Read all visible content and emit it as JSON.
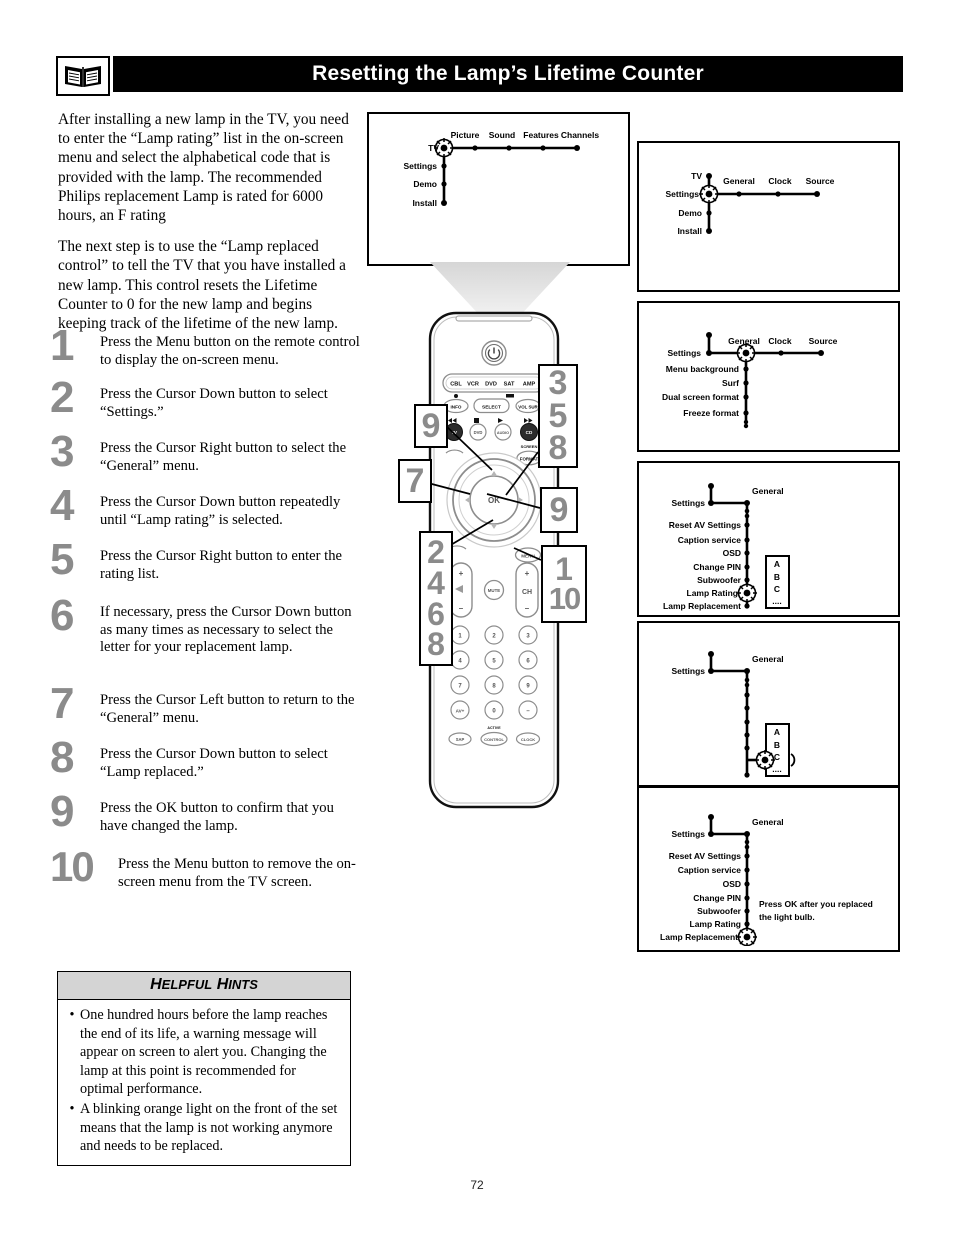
{
  "header": {
    "icon": "open-book-icon",
    "title": "Resetting the Lamp’s Lifetime Counter"
  },
  "intro": {
    "paragraph1": "After installing a new lamp in the TV, you need to enter the “Lamp rating” list in the on-screen menu and select the alphabetical code that is provided with the lamp. The recommended Philips replacement Lamp is rated for 6000 hours, an F rating",
    "paragraph2": "The next step is to use the “Lamp replaced control” to tell the TV that you have installed a new lamp. This control resets the Lifetime Counter to 0 for the new lamp and begins keeping track of the lifetime of the new lamp."
  },
  "steps": [
    {
      "num": "1",
      "text": "Press the Menu button on the remote control to display the on-screen menu."
    },
    {
      "num": "2",
      "text": "Press the Cursor Down button to select “Settings.”"
    },
    {
      "num": "3",
      "text": "Press the Cursor Right button to select the “General” menu."
    },
    {
      "num": "4",
      "text": "Press the Cursor Down button repeatedly until “Lamp rating” is selected."
    },
    {
      "num": "5",
      "text": "Press the Cursor Right button to enter the rating list."
    },
    {
      "num": "6",
      "text": "If necessary, press the Cursor Down button as many times as necessary to select the letter for your replacement lamp."
    },
    {
      "num": "7",
      "text": "Press the Cursor Left button to return to the “General” menu."
    },
    {
      "num": "8",
      "text": "Press the Cursor Down button to select “Lamp replaced.”"
    },
    {
      "num": "9",
      "text": "Press the OK button to confirm that you have changed the lamp."
    },
    {
      "num": "10",
      "text": "Press the Menu button to remove the on-screen menu from the TV screen."
    }
  ],
  "hints": {
    "title_first": "H",
    "title_rest1": "ELPFUL",
    "title_second": "H",
    "title_rest2": "INTS",
    "bullet": "•",
    "items": [
      "One hundred hours before the lamp reaches the end of its life, a warning message will appear on screen to alert you. Changing the lamp at this point is recommended for optimal performance.",
      "A blinking orange light on the front of the set means that the lamp is not working anymore and needs to be replaced."
    ]
  },
  "tv_screen_menu": {
    "root": "TV",
    "vertical": [
      "Settings",
      "Demo",
      "Install"
    ],
    "horizontal": [
      "Picture",
      "Sound",
      "Features",
      "Channels"
    ],
    "cursor_on": "TV"
  },
  "panels": [
    {
      "id": "panel-settings-general",
      "vertical": [
        "TV",
        "Settings",
        "Demo",
        "Install"
      ],
      "horizontal": [
        "General",
        "Clock",
        "Source"
      ],
      "cursor_on": "Settings"
    },
    {
      "id": "panel-general-submenu",
      "left_label": "Settings",
      "horizontal": [
        "General",
        "Clock",
        "Source"
      ],
      "vertical": [
        "Menu background",
        "Surf",
        "Dual screen format",
        "Freeze format"
      ],
      "cursor_on": "General"
    },
    {
      "id": "panel-lamp-rating",
      "left_label": "Settings",
      "branch_label": "General",
      "vertical": [
        "Reset AV Settings",
        "Caption service",
        "OSD",
        "Change PIN",
        "Subwoofer",
        "Lamp Rating",
        "Lamp Replacement"
      ],
      "cursor_on": "Lamp Rating",
      "rating_list": [
        "A",
        "B",
        "C",
        "...."
      ]
    },
    {
      "id": "panel-rating-select",
      "left_label": "Settings",
      "branch_label": "General",
      "rating_list": [
        "A",
        "B",
        "C",
        "...."
      ],
      "cursor_on": "C"
    },
    {
      "id": "panel-lamp-replacement",
      "left_label": "Settings",
      "branch_label": "General",
      "vertical": [
        "Reset AV Settings",
        "Caption service",
        "OSD",
        "Change PIN",
        "Subwoofer",
        "Lamp Rating",
        "Lamp Replacement"
      ],
      "cursor_on": "Lamp Replacement",
      "note_line1": "Press OK after you replaced",
      "note_line2": "the light bulb."
    }
  ],
  "remote": {
    "power_icon": "power-icon",
    "mode_buttons": [
      "CBL",
      "VCR",
      "DVD",
      "SAT",
      "AMP"
    ],
    "row_buttons": [
      "INFO",
      "SELECT",
      "VOL SUR"
    ],
    "transport_buttons": [
      "TV",
      "DVD",
      "AUDIO",
      "CD"
    ],
    "screen_label": "SCREEN",
    "format_button": "FORMAT",
    "ok_button": "OK",
    "menu_button": "MENU",
    "volume_plus": "+",
    "volume_minus": "–",
    "mute_button": "MUTE",
    "channel_label": "CH",
    "channel_plus": "+",
    "channel_minus": "–",
    "keypad": [
      "1",
      "2",
      "3",
      "4",
      "5",
      "6",
      "7",
      "8",
      "9",
      "AV+",
      "0",
      "–"
    ],
    "bottom_buttons": [
      "SAP",
      "CONTROL",
      "CLOCK"
    ],
    "active_label": "ACTIVE"
  },
  "callouts": [
    {
      "id": "callout-358",
      "values": [
        "3",
        "5",
        "8"
      ]
    },
    {
      "id": "callout-9-up",
      "values": [
        "9"
      ]
    },
    {
      "id": "callout-7",
      "values": [
        "7"
      ]
    },
    {
      "id": "callout-9-ok",
      "values": [
        "9"
      ]
    },
    {
      "id": "callout-2468",
      "values": [
        "2",
        "4",
        "6",
        "8"
      ]
    },
    {
      "id": "callout-1-10",
      "values": [
        "1",
        "10"
      ]
    }
  ],
  "page_number": "72"
}
